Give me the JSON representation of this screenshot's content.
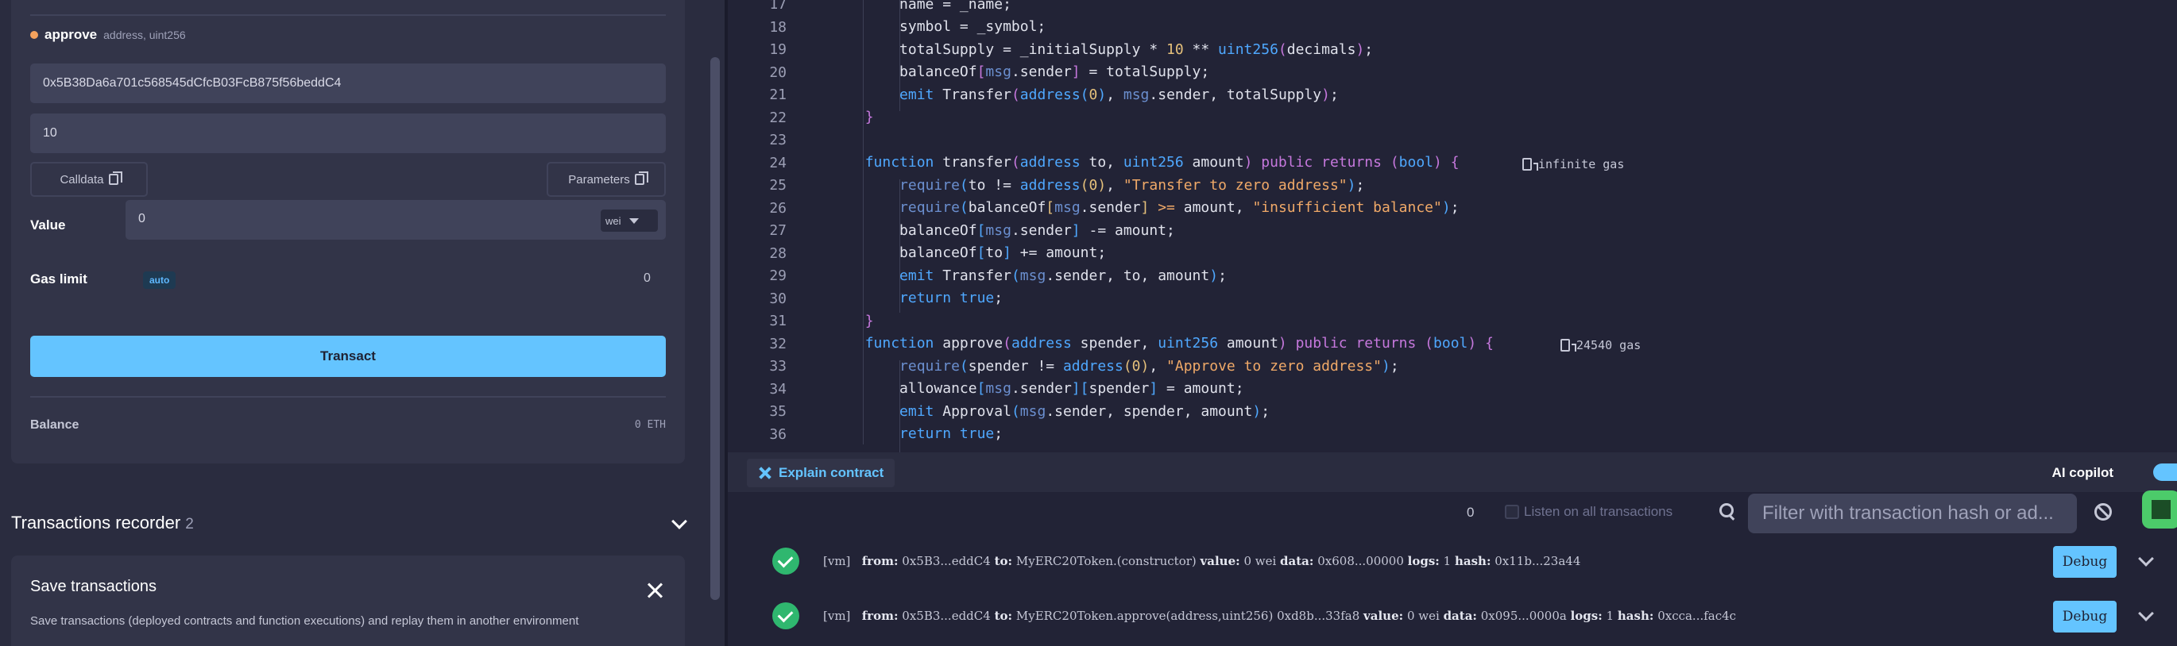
{
  "approve": {
    "name": "approve",
    "params": "address, uint256",
    "address_value": "0x5B38Da6a701c568545dCfcB03FcB875f56beddC4",
    "amount_value": "10",
    "calldata_label": "Calldata",
    "parameters_label": "Parameters"
  },
  "tx_form": {
    "value_label": "Value",
    "value": "0",
    "unit": "wei",
    "gas_limit_label": "Gas limit",
    "gas_mode": "auto",
    "gas_value": "0",
    "transact_label": "Transact",
    "balance_label": "Balance",
    "balance_value": "0 ETH"
  },
  "recorder": {
    "title": "Transactions recorder",
    "count": "2",
    "save_title": "Save transactions",
    "save_desc": "Save transactions (deployed contracts and function executions) and replay them in another environment"
  },
  "editor": {
    "line_numbers": [
      "17",
      "18",
      "19",
      "20",
      "21",
      "22",
      "23",
      "24",
      "25",
      "26",
      "27",
      "28",
      "29",
      "30",
      "31",
      "32",
      "33",
      "34",
      "35",
      "36"
    ],
    "gas_hint_transfer": "infinite gas",
    "gas_hint_approve": "24540 gas",
    "explain_label": "Explain contract",
    "copilot_label": "AI copilot"
  },
  "terminal": {
    "count": "0",
    "listen_label": "Listen on all transactions",
    "filter_placeholder": "Filter with transaction hash or ad...",
    "debug_label": "Debug",
    "tx1": {
      "vm": "[vm]",
      "from": "0x5B3...eddC4",
      "to": "MyERC20Token.(constructor)",
      "value": "0 wei",
      "data": "0x608...00000",
      "logs": "1",
      "hash": "0x11b...23a44"
    },
    "tx2": {
      "vm": "[vm]",
      "from": "0x5B3...eddC4",
      "to": "MyERC20Token.approve(address,uint256) 0xd8b...33fa8",
      "value": "0 wei",
      "data": "0x095...0000a",
      "logs": "1",
      "hash": "0xcca...fac4c"
    },
    "labels": {
      "from": "from:",
      "to": "to:",
      "value": "value:",
      "data": "data:",
      "logs": "logs:",
      "hash": "hash:"
    }
  }
}
